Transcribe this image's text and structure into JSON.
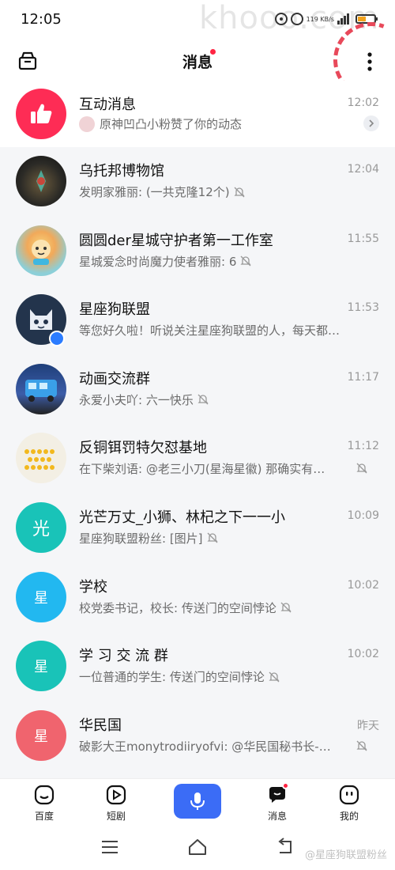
{
  "status_bar": {
    "time": "12:05",
    "network_speed": "119 KB/s",
    "watermark": "khooo.com"
  },
  "header": {
    "title": "消息",
    "left_icon": "archive-box-icon",
    "right_icon": "more-vertical-icon",
    "has_unread_dot": true
  },
  "interaction_row": {
    "title": "互动消息",
    "subtitle": "原神凹凸小粉赞了你的动态",
    "time": "12:02",
    "icon": "thumbs-up-icon",
    "accent": "#fe2c55"
  },
  "conversations": [
    {
      "title": "乌托邦博物馆",
      "subtitle": "发明家雅丽: (一共克隆12个)",
      "time": "12:04",
      "avatar_color": "#2b2a26",
      "avatar_text": "",
      "muted": true
    },
    {
      "title": "圆圆der星城守护者第一工作室",
      "subtitle": "星城爱念时尚魔力使者雅丽: 6",
      "time": "11:55",
      "avatar_color": "#8ccfd8",
      "avatar_text": "",
      "muted": true
    },
    {
      "title": "星座狗联盟",
      "subtitle": "等您好久啦！听说关注星座狗联盟的人，每天都…",
      "time": "11:53",
      "avatar_color": "#23344c",
      "avatar_text": "",
      "muted": false,
      "verified": true
    },
    {
      "title": "动画交流群",
      "subtitle": "永爱小夫吖: 六一快乐",
      "time": "11:17",
      "avatar_color": "#3c5da8",
      "avatar_text": "",
      "muted": true
    },
    {
      "title": "反铜铒罚特欠怼基地",
      "subtitle": "在下柴刘语: @老三小刀(星海星徽) 那确实有…",
      "time": "11:12",
      "avatar_color": "#f3efe4",
      "avatar_text": "",
      "muted": true
    },
    {
      "title": "光芒万丈_小狮、林杞之下一一小",
      "subtitle": "星座狗联盟粉丝: [图片]",
      "time": "10:09",
      "avatar_color": "#19c3b8",
      "avatar_text": "光",
      "muted": true
    },
    {
      "title": "学校",
      "subtitle": "校党委书记，校长: 传送门的空间悖论",
      "time": "10:02",
      "avatar_color": "#22b8f0",
      "avatar_text": "星",
      "muted": true
    },
    {
      "title": "学 习 交 流 群",
      "subtitle": "一位普通的学生: 传送门的空间悖论",
      "time": "10:02",
      "avatar_color": "#19c3b8",
      "avatar_text": "星",
      "muted": true
    },
    {
      "title": "华民国",
      "subtitle": "破影大王monytrodiiryofvi: @华民国秘书长-…",
      "time": "昨天",
      "avatar_color": "#f0646e",
      "avatar_text": "星",
      "muted": true
    }
  ],
  "bottom_nav": {
    "items": [
      {
        "label": "百度",
        "icon": "baidu-face-icon"
      },
      {
        "label": "短剧",
        "icon": "play-square-icon"
      },
      {
        "label": "",
        "icon": "microphone-icon"
      },
      {
        "label": "消息",
        "icon": "message-bubble-icon",
        "active": true,
        "dot": true
      },
      {
        "label": "我的",
        "icon": "profile-face-icon"
      }
    ]
  },
  "credit": "@星座狗联盟粉丝"
}
